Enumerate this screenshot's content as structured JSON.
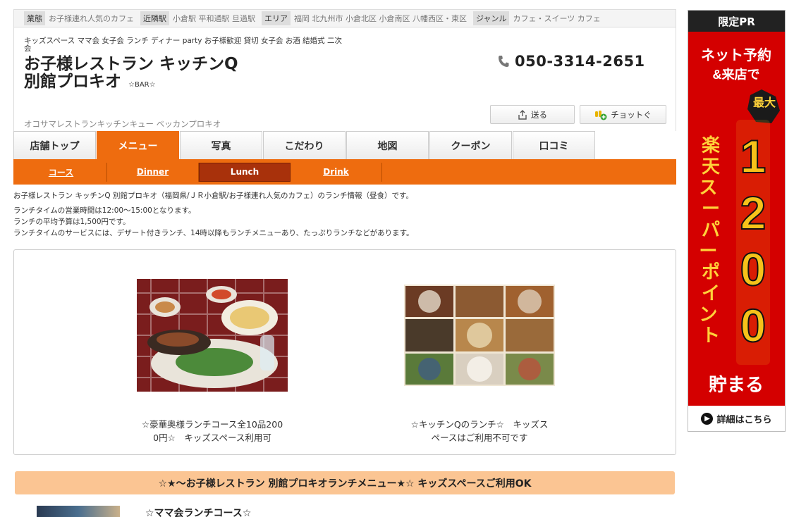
{
  "info_bar": [
    {
      "label": "業態",
      "value": "お子様連れ人気のカフェ"
    },
    {
      "label": "近隣駅",
      "value": "小倉駅 平和通駅 旦過駅"
    },
    {
      "label": "エリア",
      "value": "福岡 北九州市 小倉北区 小倉南区 八幡西区・東区"
    },
    {
      "label": "ジャンル",
      "value": "カフェ・スイーツ カフェ"
    }
  ],
  "header": {
    "tags": "キッズスペース ママ会 女子会 ランチ ディナー party お子様歓迎 貸切 女子会 お酒 結婚式 二次会",
    "name_line1": "お子様レストラン キッチンQ",
    "name_line2": "別館プロキオ",
    "name_sub": "☆BAR☆",
    "kana": "オコサマレストランキッチンキュー ベッカンプロキオ",
    "phone": "050-3314-2651",
    "send_label": "送る",
    "chotto_label": "チョットぐ"
  },
  "tabs": [
    {
      "label": "店舗トップ",
      "active": false
    },
    {
      "label": "メニュー",
      "active": true
    },
    {
      "label": "写真",
      "active": false
    },
    {
      "label": "こだわり",
      "active": false
    },
    {
      "label": "地図",
      "active": false
    },
    {
      "label": "クーポン",
      "active": false
    },
    {
      "label": "口コミ",
      "active": false
    }
  ],
  "subnav": [
    {
      "label": "コース",
      "active": false
    },
    {
      "label": "Dinner",
      "active": false
    },
    {
      "label": "Lunch",
      "active": true
    },
    {
      "label": "Drink",
      "active": false
    }
  ],
  "description": {
    "line1": "お子様レストラン キッチンQ 別館プロキオ（福岡県/ＪＲ小倉駅/お子様連れ人気のカフェ）のランチ情報（昼食）です。",
    "line2": "ランチタイムの営業時間は12:00～15:00となります。",
    "line3": "ランチの平均予算は1,500円です。",
    "line4": "ランチタイムのサービスには、デザート付きランチ、14時以降もランチメニューあり、たっぷりランチなどがあります。"
  },
  "photos": [
    {
      "caption_l1": "☆豪華奥様ランチコース全10品200",
      "caption_l2": "0円☆　キッズスペース利用可"
    },
    {
      "caption_l1": "☆キッチンQのランチ☆　キッズス",
      "caption_l2": "ペースはご利用不可です"
    }
  ],
  "menu_heading": "☆★～お子様レストラン 別館プロキオランチメニュー★☆ キッズスペースご利用OK",
  "course_title": "☆ママ会ランチコース☆",
  "ad": {
    "top": "限定PR",
    "line1": "ネット予約",
    "line2": "&来店で",
    "max_badge": "最大",
    "brand": "楽天スーパーポイント",
    "points": "1200",
    "suffix": "貯まる",
    "cta": "詳細はこちら"
  },
  "colors": {
    "accent": "#ee6c0f",
    "active_sub": "#a8310b",
    "menu_bar": "#fbc593",
    "ad_red": "#d40000"
  }
}
